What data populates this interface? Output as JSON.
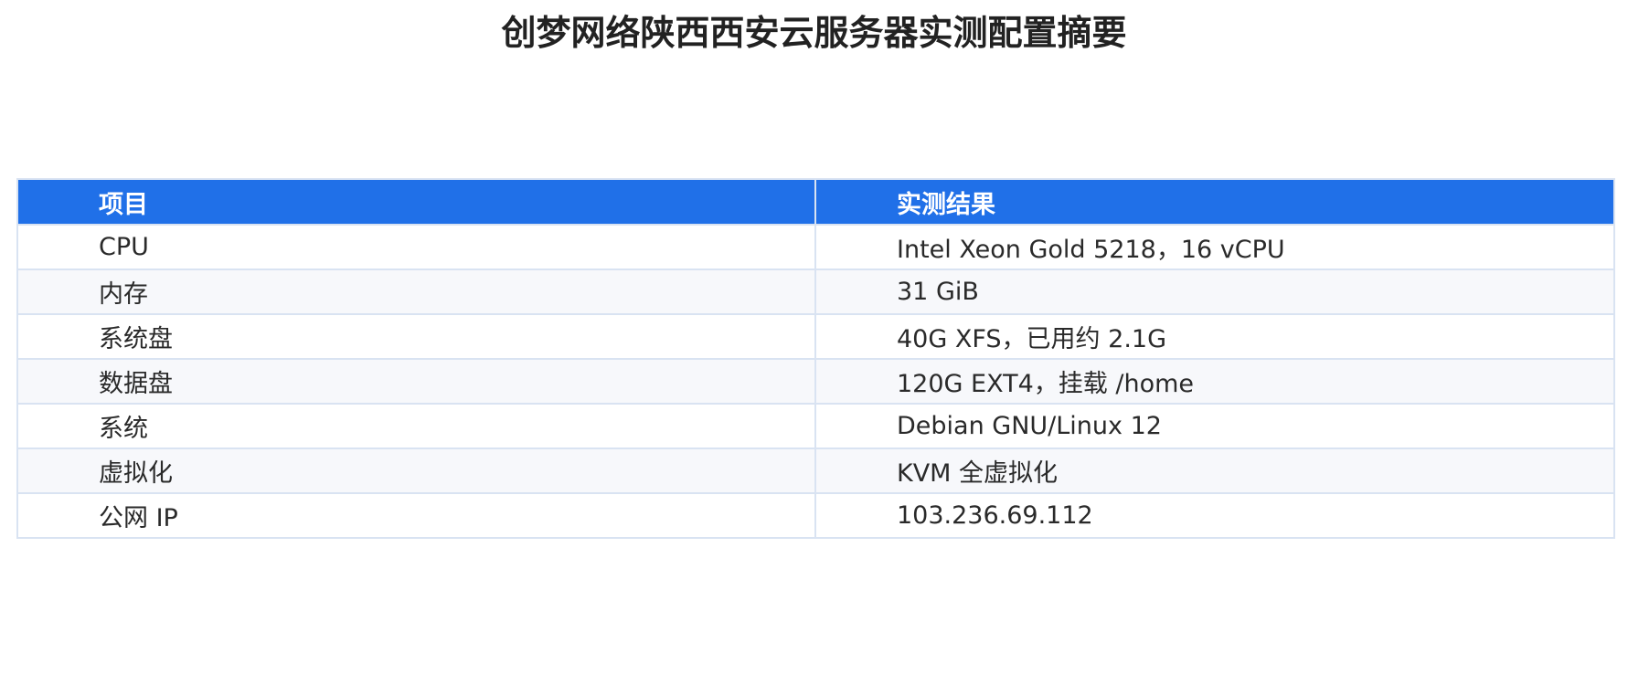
{
  "title": "创梦网络陕西西安云服务器实测配置摘要",
  "table": {
    "headers": [
      "项目",
      "实测结果"
    ],
    "rows": [
      [
        "CPU",
        "Intel Xeon Gold 5218，16 vCPU"
      ],
      [
        "内存",
        "31 GiB"
      ],
      [
        "系统盘",
        "40G XFS，已用约 2.1G"
      ],
      [
        "数据盘",
        "120G EXT4，挂载 /home"
      ],
      [
        "系统",
        "Debian GNU/Linux 12"
      ],
      [
        "虚拟化",
        "KVM 全虚拟化"
      ],
      [
        "公网 IP",
        "103.236.69.112"
      ]
    ]
  },
  "colors": {
    "header_background": "#2070e8",
    "header_text": "#ffffff",
    "border": "#d9e3f2",
    "stripe": "#f7f8fb"
  }
}
